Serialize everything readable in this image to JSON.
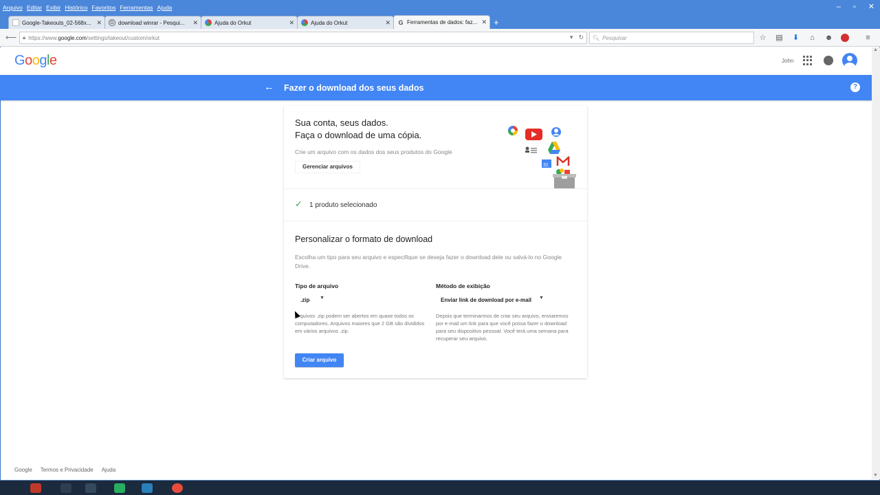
{
  "browser": {
    "menu": [
      "Arquivo",
      "Editar",
      "Exibir",
      "Histórico",
      "Favoritos",
      "Ferramentas",
      "Ajuda"
    ],
    "tabs": [
      {
        "title": "Google-Takeouts_02-568x...",
        "active": false
      },
      {
        "title": "download winrar - Pesqui...",
        "active": false
      },
      {
        "title": "Ajuda do Orkut",
        "active": false
      },
      {
        "title": "Ajuda do Orkut",
        "active": false
      },
      {
        "title": "Ferramentas de dados: faz...",
        "active": true
      }
    ],
    "url_prefix": "https://www.",
    "url_host": "google.com",
    "url_path": "/settings/takeout/custom/orkut",
    "search_placeholder": "Pesquisar"
  },
  "header": {
    "logo": "Google",
    "user_name": "John"
  },
  "bluebar": {
    "title": "Fazer o download dos seus dados",
    "help": "?"
  },
  "card": {
    "heading_line1": "Sua conta, seus dados.",
    "heading_line2": "Faça o download de uma cópia.",
    "subtitle": "Crie um arquivo com os dados dos seus produtos do Google",
    "manage_button": "Gerenciar arquivos",
    "selected_products": "1 produto selecionado",
    "customize_heading": "Personalizar o formato de download",
    "customize_desc": "Escolha um tipo para seu arquivo e especifique se deseja fazer o download dele ou salvá-lo no Google Drive.",
    "file_type": {
      "label": "Tipo de arquivo",
      "value": ".zip",
      "help": "Arquivos .zip podem ser abertos em quase todos os computadores. Arquivos maiores que 2 GB são divididos em vários arquivos .zip."
    },
    "delivery": {
      "label": "Método de exibição",
      "value": "Enviar link de download por e-mail",
      "help": "Depois que terminarmos de criar seu arquivo, enviaremos por e-mail um link para que você possa fazer o download para seu dispositivo pessoal. Você terá uma semana para recuperar seu arquivo."
    },
    "create_button": "Criar arquivo"
  },
  "footer": {
    "links": [
      "Google",
      "Termos e Privacidade",
      "Ajuda"
    ]
  },
  "colors": {
    "google_blue": "#4285f4",
    "check_green": "#34a853"
  }
}
